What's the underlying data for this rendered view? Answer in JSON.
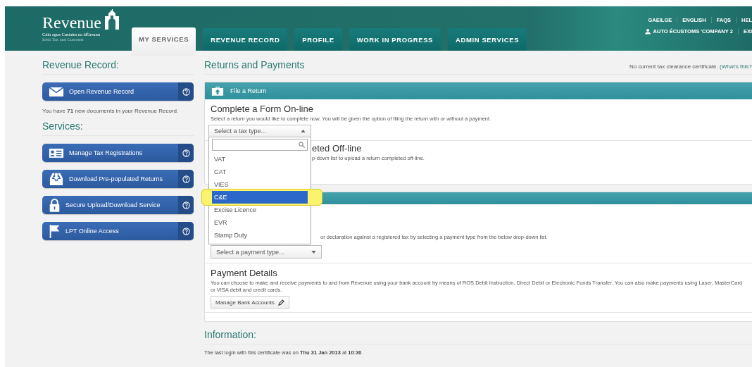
{
  "header": {
    "logo": {
      "name": "Revenue",
      "tagline_irish": "Cáin agus Custaim na hÉireann",
      "tagline_english": "Irish Tax and Customs"
    },
    "tabs": [
      {
        "label": "MY SERVICES",
        "selected": true
      },
      {
        "label": "REVENUE RECORD",
        "selected": false
      },
      {
        "label": "PROFILE",
        "selected": false
      },
      {
        "label": "WORK IN PROGRESS",
        "selected": false
      },
      {
        "label": "ADMIN SERVICES",
        "selected": false
      }
    ],
    "top_links": [
      "GAEILGE",
      "ENGLISH",
      "FAQS",
      "HEL"
    ],
    "user": {
      "name": "AUTO ÉCUSTOMS 'COMPANY 2",
      "link": "EXI"
    }
  },
  "sidebar": {
    "record_heading": "Revenue Record:",
    "record_button": {
      "label": "Open Revenue Record",
      "kind": "envelope"
    },
    "record_note": "You have **71** new documents in your Revenue Record.",
    "services_heading": "Services:",
    "services": [
      {
        "label": "Manage Tax Registrations",
        "kind": "id-card"
      },
      {
        "label": "Download Pre-populated Returns",
        "kind": "download"
      },
      {
        "label": "Secure Upload/Download Service",
        "kind": "padlock"
      },
      {
        "label": "LPT Online Access",
        "kind": "flag"
      }
    ]
  },
  "main": {
    "heading": "Returns and Payments",
    "clearance_note": "No current tax clearance certificate.",
    "clearance_link": "(What's this?",
    "file_return": {
      "title": "File a Return",
      "online": {
        "title": "Complete a Form On-line",
        "description": "Select a return you would like to complete now. You will be given the option of filing the return with or without a payment.",
        "select": {
          "placeholder": "Select a tax type...",
          "expanded": true,
          "options": [
            {
              "label": "VAT",
              "selected": false
            },
            {
              "label": "CAT",
              "selected": false
            },
            {
              "label": "VIES",
              "selected": false
            },
            {
              "label": "C&E",
              "selected": true
            },
            {
              "label": "Excise Licence",
              "selected": false
            },
            {
              "label": "EVR",
              "selected": false
            },
            {
              "label": "Stamp Duty",
              "selected": false
            }
          ]
        }
      },
      "offline": {
        "title": "eted Off-line",
        "description": "p-down list to upload a return completed off-line."
      }
    },
    "payments": {
      "description": "or declaration against a registered tax by selecting a payment type from the below drop-down list.",
      "select_placeholder": "Select a payment type...",
      "details_title": "Payment Details",
      "details_description": "You can choose to make and receive payments to and from Revenue using your bank account by means of ROS Debit Instruction, Direct Debit or Electronic Funds Transfer. You can also make payments using Laser, MasterCard or VISA debit and credit cards.",
      "bank_button": "Manage Bank Accounts"
    },
    "information": {
      "heading": "Information:",
      "last_login": "The last login with this certificate was on **Thu 31 Jan 2013** at **10:30**"
    }
  }
}
